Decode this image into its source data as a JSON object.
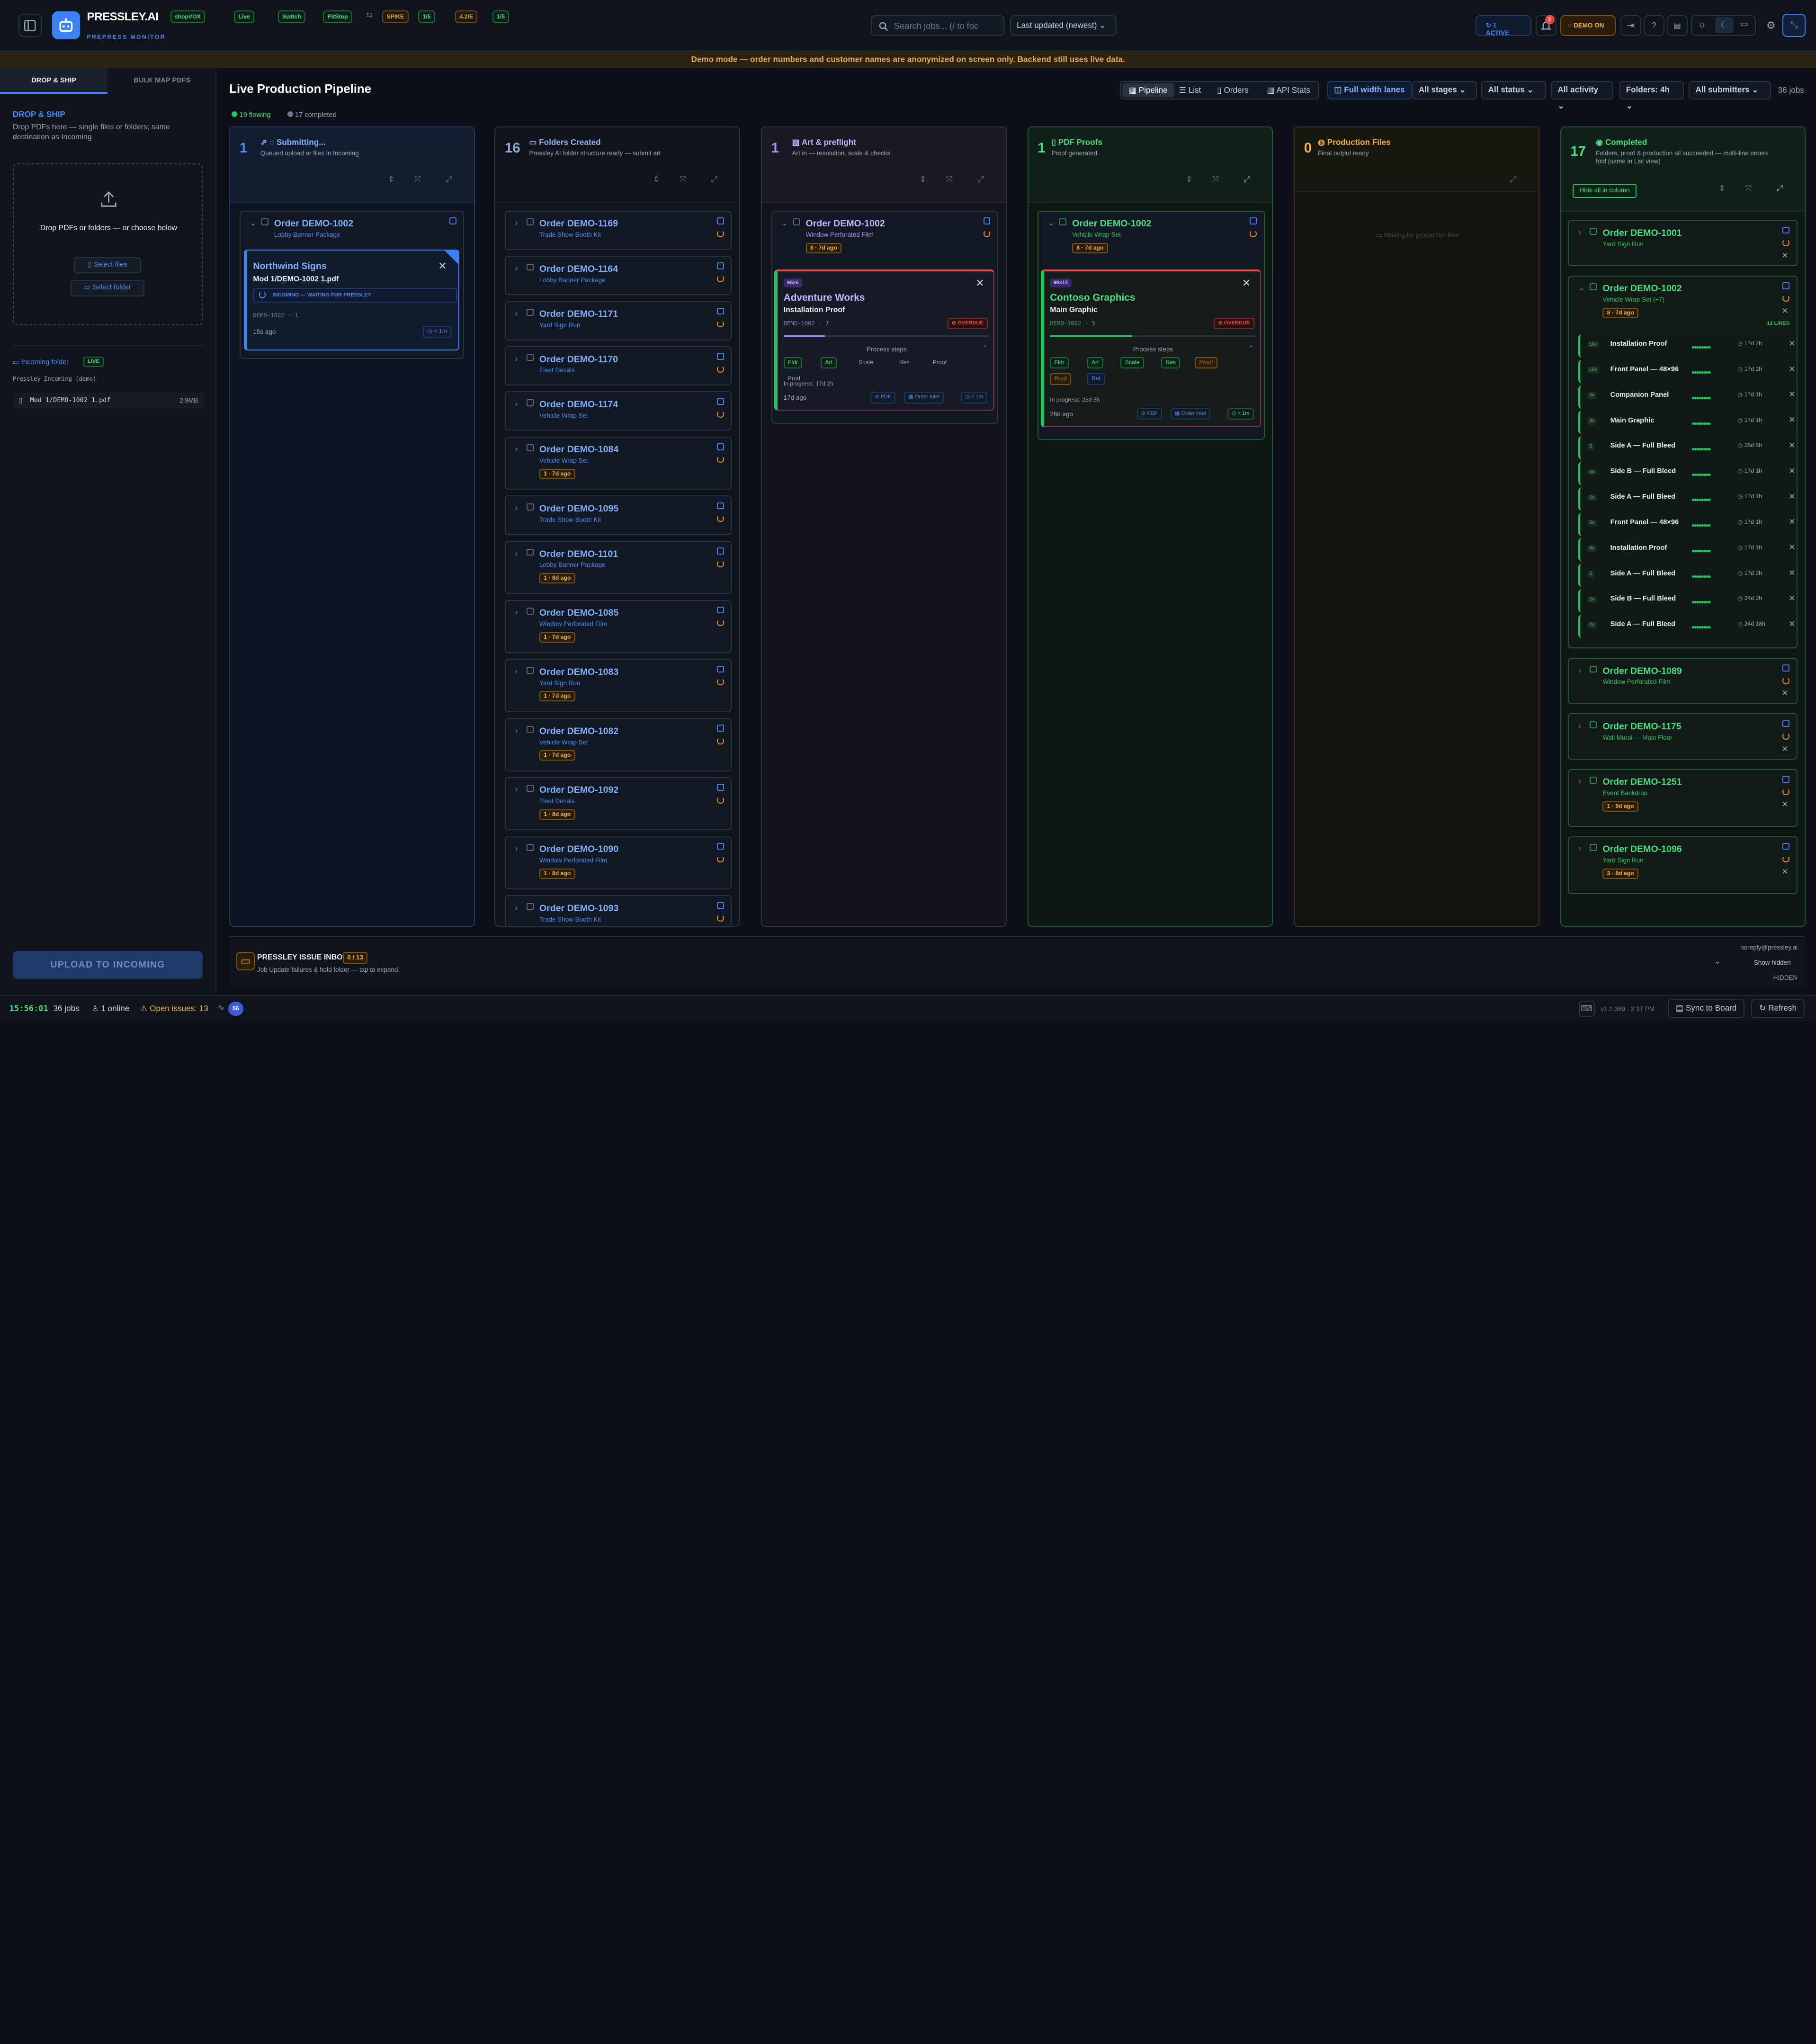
{
  "app": {
    "name": "PRESSLEY.AI",
    "subtitle": "PREPRESS MONITOR"
  },
  "top_pills": [
    {
      "label": "shopVOX"
    },
    {
      "label": "Live"
    },
    {
      "label": "Switch"
    },
    {
      "label": "PitStop"
    }
  ],
  "top_metrics": [
    {
      "label": "SPIKE"
    },
    {
      "label": "1/5"
    },
    {
      "label": "4.2/E"
    },
    {
      "label": "1/5"
    }
  ],
  "search": {
    "placeholder": "Search jobs... (/ to foc",
    "sort": "Last updated (newest)"
  },
  "header_right": {
    "active": "1 ACTIVE",
    "notif_count": "1",
    "demo": "DEMO ON"
  },
  "banner": "Demo mode — order numbers and customer names are anonymized on screen only. Backend still uses live data.",
  "left": {
    "tabs": [
      "DROP & SHIP",
      "BULK MAP PDFS"
    ],
    "title": "DROP & SHIP",
    "desc": "Drop PDFs here — single files or folders; same destination as Incoming",
    "drop_text": "Drop PDFs or folders — or choose below",
    "select_files": "Select files",
    "select_folder": "Select folder",
    "incoming_label": "Incoming folder",
    "live": "LIVE",
    "incoming_path": "Pressley Incoming (demo)",
    "file": {
      "name": "Mod 1/DEMO-1002 1.pdf",
      "size": "2.9MB"
    },
    "upload": "UPLOAD TO INCOMING"
  },
  "main": {
    "title": "Live Production Pipeline",
    "flowing": "19 flowing",
    "completed": "17 completed",
    "views": [
      "Pipeline",
      "List",
      "Orders",
      "API Stats"
    ],
    "full_width": "Full width lanes",
    "filters": [
      "All stages",
      "All status",
      "All activity",
      "Folders: 4h",
      "All submitters"
    ],
    "jobs": "36 jobs"
  },
  "columns": {
    "submitting": {
      "count": "1",
      "title": "Submitting...",
      "sub": "Queued upload or files in Incoming",
      "card": {
        "order": "Order DEMO-1002",
        "product": "Lobby Banner Package",
        "customer": "Northwind Signs",
        "file": "Mod 1/DEMO-1002 1.pdf",
        "status": "INCOMING — WAITING FOR PRESSLEY",
        "meta": "DEMO-1002 · 1",
        "time": "15s ago",
        "dur": "< 1m"
      }
    },
    "folders": {
      "count": "16",
      "title": "Folders Created",
      "sub": "Pressley AI folder structure ready — submit art",
      "cards": [
        {
          "order": "Order DEMO-1169",
          "product": "Trade Show Booth Kit",
          "ago": ""
        },
        {
          "order": "Order DEMO-1164",
          "product": "Lobby Banner Package",
          "ago": ""
        },
        {
          "order": "Order DEMO-1171",
          "product": "Yard Sign Run",
          "ago": ""
        },
        {
          "order": "Order DEMO-1170",
          "product": "Fleet Decals",
          "ago": ""
        },
        {
          "order": "Order DEMO-1174",
          "product": "Vehicle Wrap Set",
          "ago": ""
        },
        {
          "order": "Order DEMO-1084",
          "product": "Vehicle Wrap Set",
          "ago": "1 · 7d ago"
        },
        {
          "order": "Order DEMO-1095",
          "product": "Trade Show Booth Kit",
          "ago": ""
        },
        {
          "order": "Order DEMO-1101",
          "product": "Lobby Banner Package",
          "ago": "1 · 8d ago"
        },
        {
          "order": "Order DEMO-1085",
          "product": "Window Perforated Film",
          "ago": "1 · 7d ago"
        },
        {
          "order": "Order DEMO-1083",
          "product": "Yard Sign Run",
          "ago": "1 · 7d ago"
        },
        {
          "order": "Order DEMO-1082",
          "product": "Vehicle Wrap Set",
          "ago": "1 · 7d ago"
        },
        {
          "order": "Order DEMO-1092",
          "product": "Fleet Decals",
          "ago": "1 · 8d ago"
        },
        {
          "order": "Order DEMO-1090",
          "product": "Window Perforated Film",
          "ago": "1 · 8d ago"
        },
        {
          "order": "Order DEMO-1093",
          "product": "Trade Show Booth Kit",
          "ago": ""
        }
      ]
    },
    "art": {
      "count": "1",
      "title": "Art & preflight",
      "sub": "Art in — resolution, scale & checks",
      "card": {
        "order": "Order DEMO-1002",
        "product": "Window Perforated Film",
        "ago": "8 · 7d ago",
        "size": "96x6",
        "customer": "Adventure Works",
        "item": "Installation Proof",
        "meta": "DEMO-1002 · 7",
        "overdue": "OVERDUE",
        "progress": 0.2,
        "steps_label": "Process steps",
        "steps": [
          "Fldr",
          "Art",
          "Scale",
          "Res",
          "Proof",
          "Prod"
        ],
        "inprog": "In progress: 17d 2h",
        "time": "17d ago",
        "pdf": "PDF",
        "intel": "Order Intel",
        "dur": "< 1m"
      }
    },
    "proofs": {
      "count": "1",
      "title": "PDF Proofs",
      "sub": "Proof generated",
      "card": {
        "order": "Order DEMO-1002",
        "product": "Vehicle Wrap Set",
        "ago": "8 · 7d ago",
        "size": "96x12",
        "customer": "Contoso Graphics",
        "item": "Main Graphic",
        "meta": "DEMO-1002 · 5",
        "overdue": "OVERDUE",
        "progress": 0.4,
        "steps_label": "Process steps",
        "steps": [
          "Fldr",
          "Art",
          "Scale",
          "Res",
          "Proof",
          "Prod",
          "Ret"
        ],
        "inprog": "In progress: 28d 5h",
        "time": "28d ago",
        "pdf": "PDF",
        "intel": "Order Intel",
        "dur": "< 1m"
      }
    },
    "production": {
      "count": "0",
      "title": "Production Files",
      "sub": "Final output ready",
      "waiting": "Waiting for production files"
    },
    "completed": {
      "count": "17",
      "title": "Completed",
      "sub": "Folders, proof & production all succeeded — multi-line orders fold (same in List view)",
      "hide": "Hide all in column",
      "cards": [
        {
          "order": "Order DEMO-1001",
          "product": "Yard Sign Run"
        },
        {
          "order": "Order DEMO-1002",
          "product": "Vehicle Wrap Set (+7)",
          "ago": "8 · 7d ago",
          "lines": "12 LINES"
        },
        {
          "order": "Order DEMO-1089",
          "product": "Window Perforated Film"
        },
        {
          "order": "Order DEMO-1175",
          "product": "Wall Mural — Main Floor"
        },
        {
          "order": "Order DEMO-1251",
          "product": "Event Backdrop",
          "ago": "1 · 9d ago"
        },
        {
          "order": "Order DEMO-1096",
          "product": "Yard Sign Run",
          "ago": "3 · 8d ago"
        }
      ],
      "lines": [
        {
          "badge": "16x",
          "name": "Installation Proof",
          "time": "17d 2h"
        },
        {
          "badge": "16x",
          "name": "Front Panel — 48×96",
          "time": "17d 2h"
        },
        {
          "badge": "6x",
          "name": "Companion Panel",
          "time": "17d 1h"
        },
        {
          "badge": "4x",
          "name": "Main Graphic",
          "time": "17d 1h"
        },
        {
          "badge": "3",
          "name": "Side A — Full Bleed",
          "time": "28d 5h"
        },
        {
          "badge": "6x",
          "name": "Side B — Full Bleed",
          "time": "17d 1h"
        },
        {
          "badge": "6x",
          "name": "Side A — Full Bleed",
          "time": "17d 1h"
        },
        {
          "badge": "6x",
          "name": "Front Panel — 48×96",
          "time": "17d 1h"
        },
        {
          "badge": "4x",
          "name": "Installation Proof",
          "time": "17d 1h"
        },
        {
          "badge": "5",
          "name": "Side A — Full Bleed",
          "time": "17d 2h"
        },
        {
          "badge": "2x",
          "name": "Side B — Full Bleed",
          "time": "24d 2h"
        },
        {
          "badge": "2x",
          "name": "Side A — Full Bleed",
          "time": "24d 18h"
        }
      ]
    }
  },
  "issue_inbox": {
    "title": "PRESSLEY ISSUE INBOX",
    "count": "0 / 13",
    "sub": "Job Update failures & hold folder — tap to expand.",
    "email": "noreply@pressley.ai",
    "show_hidden": "Show hidden",
    "hidden": "HIDDEN"
  },
  "statusbar": {
    "time": "15:56:01",
    "jobs": "36 jobs",
    "online": "1 online",
    "issues": "Open issues: 13",
    "activity": "56",
    "version": "v1.1.389 · 2:37 PM",
    "sync": "Sync to Board",
    "refresh": "Refresh"
  },
  "colors": {
    "accent": "#3b82f6",
    "success": "#22c55e",
    "warning": "#f59e0b",
    "danger": "#ef4444",
    "purple": "#a78bfa"
  }
}
